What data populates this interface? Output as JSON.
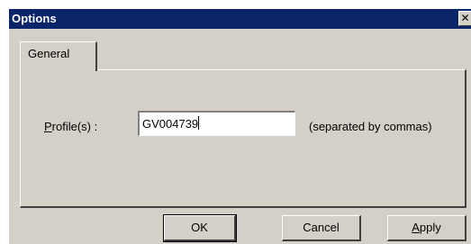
{
  "window": {
    "title": "Options",
    "close_glyph": "✕",
    "close_icon": "close-icon"
  },
  "tabs": [
    {
      "label": "General",
      "selected": true
    }
  ],
  "form": {
    "label_accel": "P",
    "label_rest": "rofile(s) :",
    "value": "GV004739",
    "hint": "(separated by commas)"
  },
  "buttons": {
    "ok": "OK",
    "cancel": "Cancel",
    "apply_accel": "A",
    "apply_rest": "pply"
  },
  "colors": {
    "titlebar": "#0a246a",
    "face": "#d4d0c8"
  }
}
